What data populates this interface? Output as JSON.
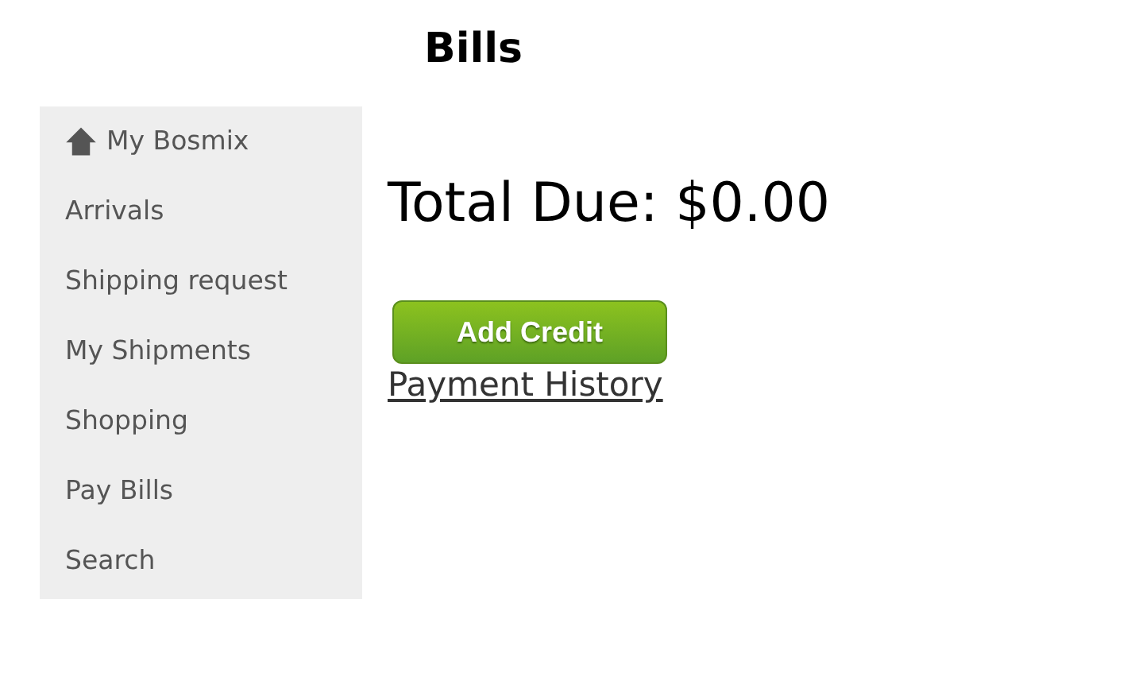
{
  "page": {
    "title": "Bills"
  },
  "sidebar": {
    "items": [
      {
        "kind": "home",
        "label": "My Bosmix"
      },
      {
        "kind": "link",
        "label": "Arrivals"
      },
      {
        "kind": "link",
        "label": "Shipping request"
      },
      {
        "kind": "link",
        "label": "My Shipments"
      },
      {
        "kind": "link",
        "label": "Shopping"
      },
      {
        "kind": "link",
        "label": "Pay Bills"
      },
      {
        "kind": "link",
        "label": "Search"
      }
    ]
  },
  "main": {
    "total_due": "Total Due: $0.00",
    "button": "Add Credit",
    "link": "Payment History"
  }
}
